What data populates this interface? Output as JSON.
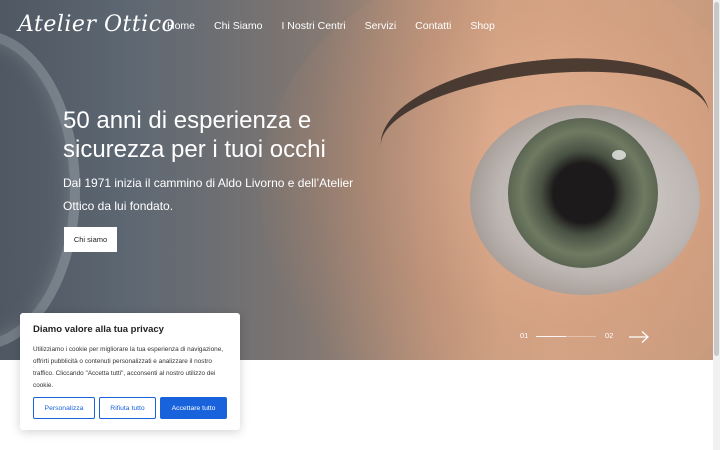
{
  "brand": {
    "logo_text": "Atelier Ottico"
  },
  "nav": {
    "items": [
      {
        "label": "Home"
      },
      {
        "label": "Chi Siamo"
      },
      {
        "label": "I Nostri Centri"
      },
      {
        "label": "Servizi"
      },
      {
        "label": "Contatti"
      },
      {
        "label": "Shop"
      }
    ]
  },
  "hero": {
    "headline": "50 anni di esperienza e sicurezza per i tuoi occhi",
    "subtext": "Dal 1971 inizia il cammino di Aldo Livorno e dell’Atelier Ottico da lui fondato.",
    "cta_label": "Chi siamo"
  },
  "slider": {
    "current": "01",
    "next": "02",
    "arrow_icon": "arrow-right-icon"
  },
  "cookie_banner": {
    "title": "Diamo valore alla tua privacy",
    "text": "Utilizziamo i cookie per migliorare la tua esperienza di navigazione, offrirti pubblicità o contenuti personalizzati e analizzare il nostro traffico. Cliccando \"Accetta tutti\", acconsenti al nostro utilizzo dei cookie.",
    "customize_label": "Personalizza",
    "reject_label": "Rifiuta tutto",
    "accept_label": "Accettare tutto",
    "accent_color": "#1863dc"
  }
}
